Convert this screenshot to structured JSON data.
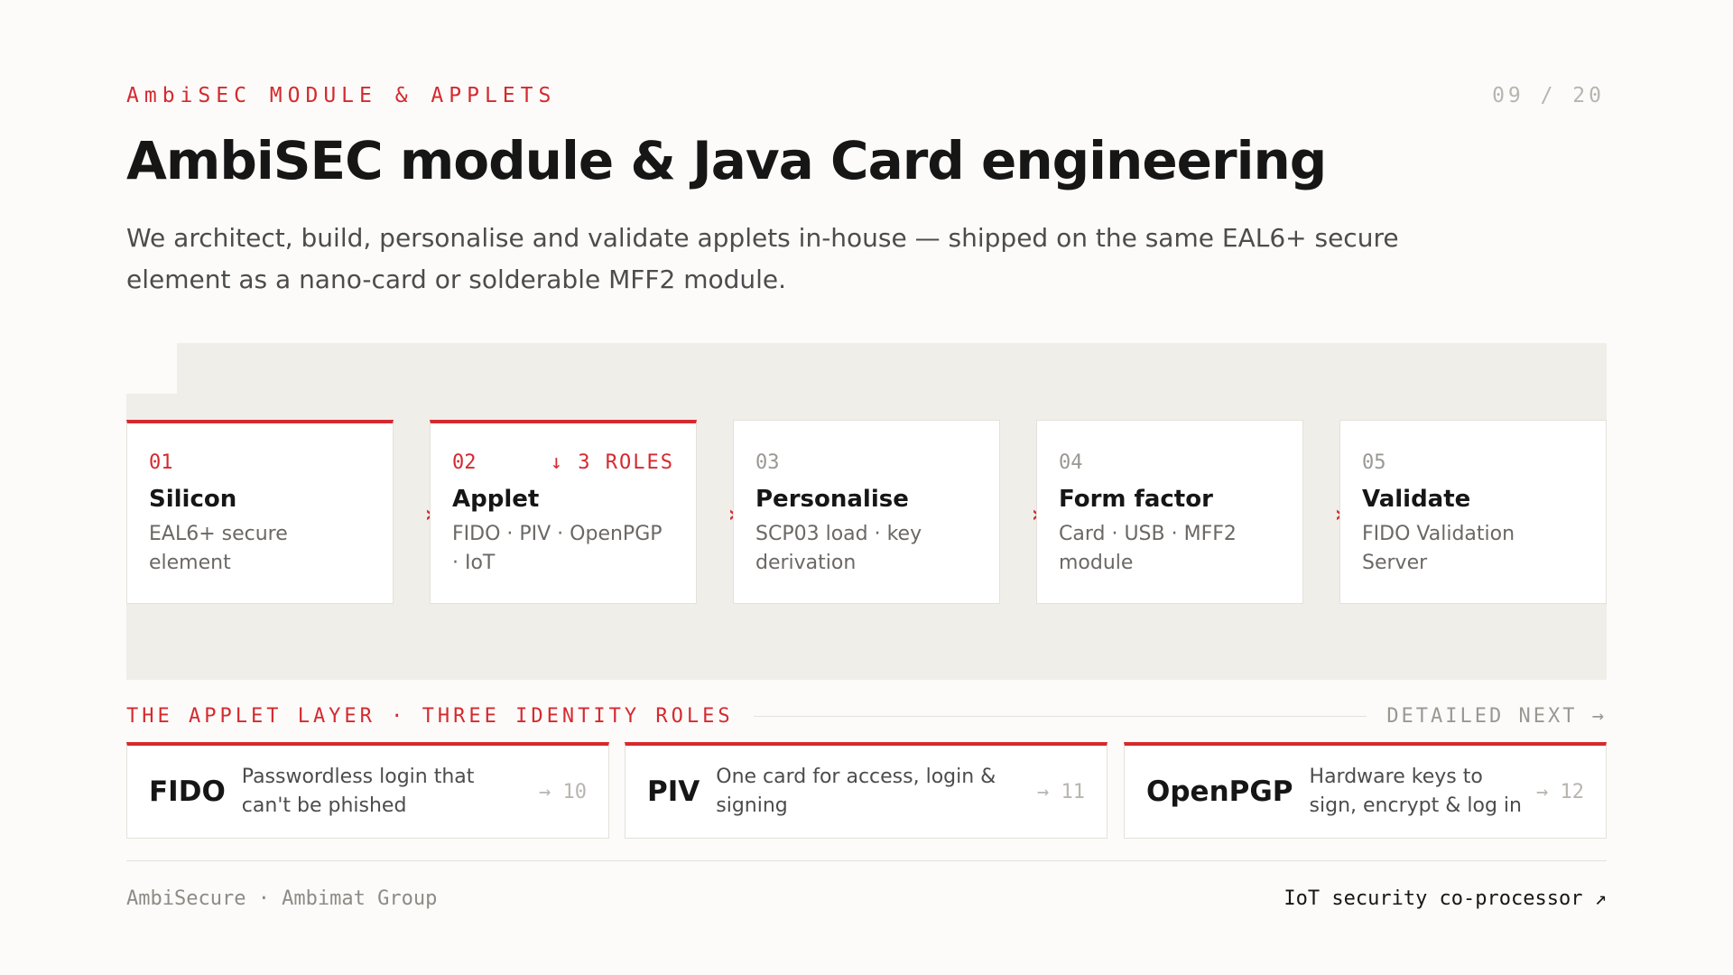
{
  "header": {
    "eyebrow": "AmbiSEC MODULE & APPLETS",
    "pager": "09 / 20",
    "title": "AmbiSEC module & Java Card engineering",
    "lede": "We architect, build, personalise and validate applets in-house — shipped on the same EAL6+ secure element as a nano-card or solderable MFF2 module."
  },
  "pipeline": {
    "arrow_glyph": "›",
    "steps": [
      {
        "num": "01",
        "name": "Silicon",
        "desc": "EAL6+ secure element",
        "active": true,
        "badge": ""
      },
      {
        "num": "02",
        "name": "Applet",
        "desc": "FIDO · PIV · OpenPGP · IoT",
        "active": true,
        "badge": "↓ 3 ROLES"
      },
      {
        "num": "03",
        "name": "Personalise",
        "desc": "SCP03 load · key derivation",
        "active": false,
        "badge": ""
      },
      {
        "num": "04",
        "name": "Form factor",
        "desc": "Card · USB · MFF2 module",
        "active": false,
        "badge": ""
      },
      {
        "num": "05",
        "name": "Validate",
        "desc": "FIDO Validation Server",
        "active": false,
        "badge": ""
      }
    ]
  },
  "applet_layer": {
    "label": "THE APPLET LAYER · THREE IDENTITY ROLES",
    "next": "DETAILED NEXT →",
    "roles": [
      {
        "name": "FIDO",
        "desc": "Passwordless login that can't be phished",
        "page": "→ 10"
      },
      {
        "name": "PIV",
        "desc": "One card for access, login & signing",
        "page": "→ 11"
      },
      {
        "name": "OpenPGP",
        "desc": "Hardware keys to sign, encrypt & log in",
        "page": "→ 12"
      }
    ]
  },
  "footer": {
    "left": "AmbiSecure · Ambimat Group",
    "right": "IoT security co-processor ↗"
  },
  "colors": {
    "accent": "#d42a2f",
    "background": "#fcfbf9",
    "stage": "#f0eee9",
    "card": "#ffffff"
  }
}
